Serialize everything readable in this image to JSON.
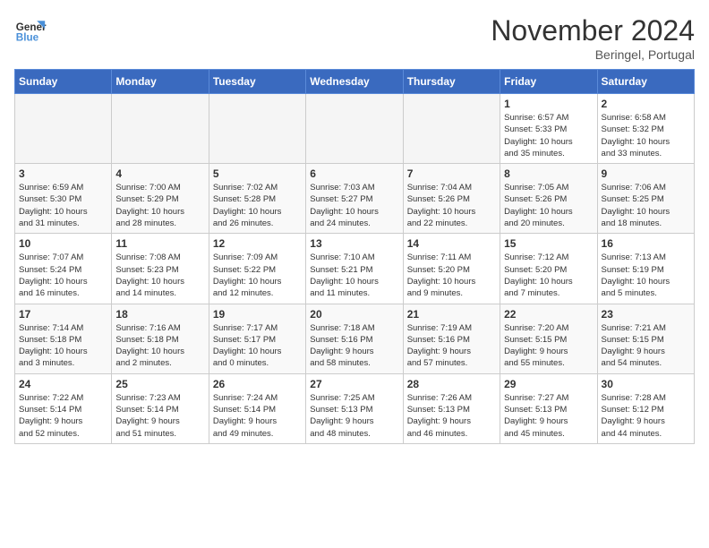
{
  "logo": {
    "line1": "General",
    "line2": "Blue"
  },
  "title": "November 2024",
  "location": "Beringel, Portugal",
  "weekdays": [
    "Sunday",
    "Monday",
    "Tuesday",
    "Wednesday",
    "Thursday",
    "Friday",
    "Saturday"
  ],
  "weeks": [
    [
      {
        "day": "",
        "info": ""
      },
      {
        "day": "",
        "info": ""
      },
      {
        "day": "",
        "info": ""
      },
      {
        "day": "",
        "info": ""
      },
      {
        "day": "",
        "info": ""
      },
      {
        "day": "1",
        "info": "Sunrise: 6:57 AM\nSunset: 5:33 PM\nDaylight: 10 hours\nand 35 minutes."
      },
      {
        "day": "2",
        "info": "Sunrise: 6:58 AM\nSunset: 5:32 PM\nDaylight: 10 hours\nand 33 minutes."
      }
    ],
    [
      {
        "day": "3",
        "info": "Sunrise: 6:59 AM\nSunset: 5:30 PM\nDaylight: 10 hours\nand 31 minutes."
      },
      {
        "day": "4",
        "info": "Sunrise: 7:00 AM\nSunset: 5:29 PM\nDaylight: 10 hours\nand 28 minutes."
      },
      {
        "day": "5",
        "info": "Sunrise: 7:02 AM\nSunset: 5:28 PM\nDaylight: 10 hours\nand 26 minutes."
      },
      {
        "day": "6",
        "info": "Sunrise: 7:03 AM\nSunset: 5:27 PM\nDaylight: 10 hours\nand 24 minutes."
      },
      {
        "day": "7",
        "info": "Sunrise: 7:04 AM\nSunset: 5:26 PM\nDaylight: 10 hours\nand 22 minutes."
      },
      {
        "day": "8",
        "info": "Sunrise: 7:05 AM\nSunset: 5:26 PM\nDaylight: 10 hours\nand 20 minutes."
      },
      {
        "day": "9",
        "info": "Sunrise: 7:06 AM\nSunset: 5:25 PM\nDaylight: 10 hours\nand 18 minutes."
      }
    ],
    [
      {
        "day": "10",
        "info": "Sunrise: 7:07 AM\nSunset: 5:24 PM\nDaylight: 10 hours\nand 16 minutes."
      },
      {
        "day": "11",
        "info": "Sunrise: 7:08 AM\nSunset: 5:23 PM\nDaylight: 10 hours\nand 14 minutes."
      },
      {
        "day": "12",
        "info": "Sunrise: 7:09 AM\nSunset: 5:22 PM\nDaylight: 10 hours\nand 12 minutes."
      },
      {
        "day": "13",
        "info": "Sunrise: 7:10 AM\nSunset: 5:21 PM\nDaylight: 10 hours\nand 11 minutes."
      },
      {
        "day": "14",
        "info": "Sunrise: 7:11 AM\nSunset: 5:20 PM\nDaylight: 10 hours\nand 9 minutes."
      },
      {
        "day": "15",
        "info": "Sunrise: 7:12 AM\nSunset: 5:20 PM\nDaylight: 10 hours\nand 7 minutes."
      },
      {
        "day": "16",
        "info": "Sunrise: 7:13 AM\nSunset: 5:19 PM\nDaylight: 10 hours\nand 5 minutes."
      }
    ],
    [
      {
        "day": "17",
        "info": "Sunrise: 7:14 AM\nSunset: 5:18 PM\nDaylight: 10 hours\nand 3 minutes."
      },
      {
        "day": "18",
        "info": "Sunrise: 7:16 AM\nSunset: 5:18 PM\nDaylight: 10 hours\nand 2 minutes."
      },
      {
        "day": "19",
        "info": "Sunrise: 7:17 AM\nSunset: 5:17 PM\nDaylight: 10 hours\nand 0 minutes."
      },
      {
        "day": "20",
        "info": "Sunrise: 7:18 AM\nSunset: 5:16 PM\nDaylight: 9 hours\nand 58 minutes."
      },
      {
        "day": "21",
        "info": "Sunrise: 7:19 AM\nSunset: 5:16 PM\nDaylight: 9 hours\nand 57 minutes."
      },
      {
        "day": "22",
        "info": "Sunrise: 7:20 AM\nSunset: 5:15 PM\nDaylight: 9 hours\nand 55 minutes."
      },
      {
        "day": "23",
        "info": "Sunrise: 7:21 AM\nSunset: 5:15 PM\nDaylight: 9 hours\nand 54 minutes."
      }
    ],
    [
      {
        "day": "24",
        "info": "Sunrise: 7:22 AM\nSunset: 5:14 PM\nDaylight: 9 hours\nand 52 minutes."
      },
      {
        "day": "25",
        "info": "Sunrise: 7:23 AM\nSunset: 5:14 PM\nDaylight: 9 hours\nand 51 minutes."
      },
      {
        "day": "26",
        "info": "Sunrise: 7:24 AM\nSunset: 5:14 PM\nDaylight: 9 hours\nand 49 minutes."
      },
      {
        "day": "27",
        "info": "Sunrise: 7:25 AM\nSunset: 5:13 PM\nDaylight: 9 hours\nand 48 minutes."
      },
      {
        "day": "28",
        "info": "Sunrise: 7:26 AM\nSunset: 5:13 PM\nDaylight: 9 hours\nand 46 minutes."
      },
      {
        "day": "29",
        "info": "Sunrise: 7:27 AM\nSunset: 5:13 PM\nDaylight: 9 hours\nand 45 minutes."
      },
      {
        "day": "30",
        "info": "Sunrise: 7:28 AM\nSunset: 5:12 PM\nDaylight: 9 hours\nand 44 minutes."
      }
    ]
  ]
}
